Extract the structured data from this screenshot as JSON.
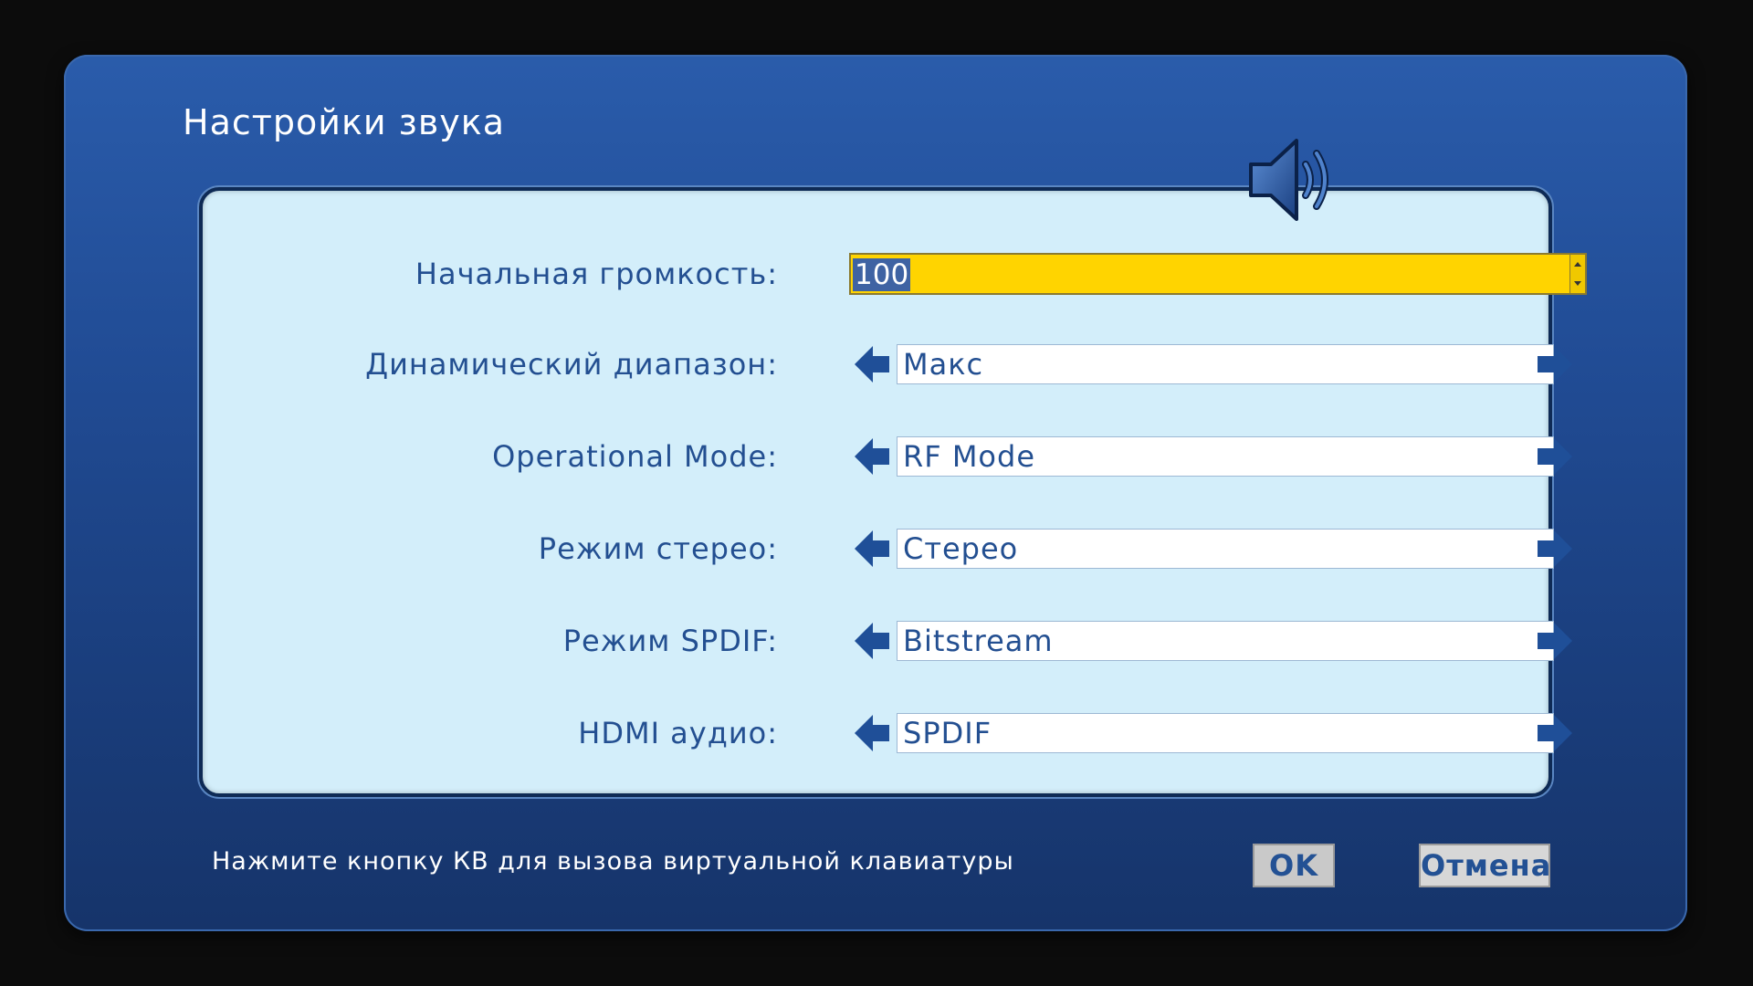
{
  "dialog": {
    "title": "Настройки звука",
    "icon": "speaker-icon"
  },
  "settings": {
    "volume": {
      "label": "Начальная громкость:",
      "value": "100"
    },
    "rows": [
      {
        "label": "Динамический диапазон:",
        "value": "Макс"
      },
      {
        "label": "Operational Mode:",
        "value": "RF Mode"
      },
      {
        "label": "Режим стерео:",
        "value": "Стерео"
      },
      {
        "label": "Режим SPDIF:",
        "value": "Bitstream"
      },
      {
        "label": "HDMI аудио:",
        "value": "SPDIF"
      }
    ]
  },
  "footer": {
    "hint": "Нажмите кнопку КВ для вызова виртуальной клавиатуры",
    "ok_label": "OK",
    "cancel_label": "Отмена"
  },
  "colors": {
    "dialog_bg": "#214c95",
    "panel_bg": "#d3eefa",
    "label_text": "#234f91",
    "focus_field": "#ffd400",
    "arrow": "#1f4f98"
  }
}
